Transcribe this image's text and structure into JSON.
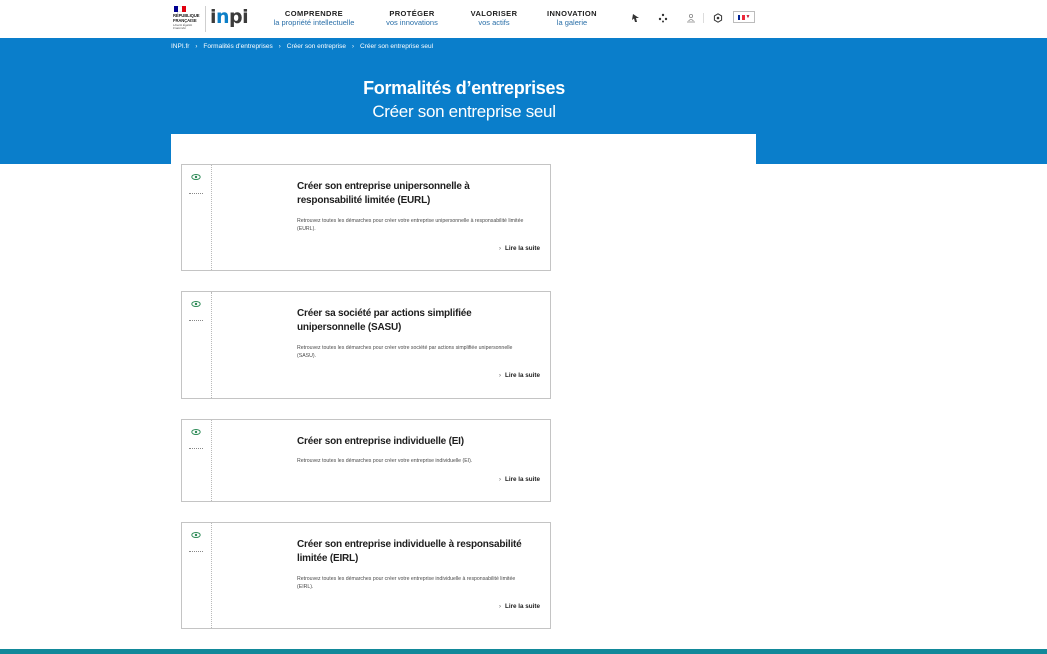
{
  "header": {
    "marianne": {
      "republic_text": "RÉPUBLIQUE FRANÇAISE",
      "motto": "Liberté Égalité Fraternité",
      "flag_colors": [
        "#000091",
        "#ffffff",
        "#e1000f"
      ]
    },
    "logo": "inpi",
    "nav": [
      {
        "title": "COMPRENDRE",
        "subtitle": "la propriété intellectuelle"
      },
      {
        "title": "PROTÉGER",
        "subtitle": "vos innovations"
      },
      {
        "title": "VALORISER",
        "subtitle": "vos actifs"
      },
      {
        "title": "INNOVATION",
        "subtitle": "la galerie"
      }
    ],
    "icons": [
      "accessibility-icon",
      "network-icon",
      "login-icon",
      "cookie-icon"
    ],
    "language": {
      "flag": "fr",
      "flag_colors": [
        "#002395",
        "#ffffff",
        "#ed2939"
      ]
    }
  },
  "breadcrumb": [
    "INPI.fr",
    "Formalités d’entreprises",
    "Créer son entreprise",
    "Créer son entreprise seul"
  ],
  "hero": {
    "title": "Formalités d’entreprises",
    "subtitle": "Créer son entreprise seul"
  },
  "cards": [
    {
      "title": "Créer son entreprise unipersonnelle à responsabilité limitée (EURL)",
      "description": "Retrouvez toutes les démarches pour créer votre entreprise unipersonnelle à responsabilité limitée (EURL).",
      "link": "Lire la suite"
    },
    {
      "title": "Créer sa société par actions simplifiée unipersonnelle (SASU)",
      "description": "Retrouvez toutes les démarches pour créer votre société par actions simplifiée unipersonnelle (SASU).",
      "link": "Lire la suite"
    },
    {
      "title": "Créer son entreprise individuelle (EI)",
      "description": "Retrouvez toutes les démarches pour créer votre entreprise individuelle (EI).",
      "link": "Lire la suite"
    },
    {
      "title": "Créer son entreprise individuelle à responsabilité limitée (EIRL)",
      "description": "Retrouvez toutes les démarches pour créer votre entreprise individuelle à responsabilité limitée (EIRL).",
      "link": "Lire la suite"
    }
  ],
  "colors": {
    "brand_blue": "#0a7ecb",
    "footer_teal": "#12899a",
    "eye_icon_green": "#2e8b57"
  }
}
